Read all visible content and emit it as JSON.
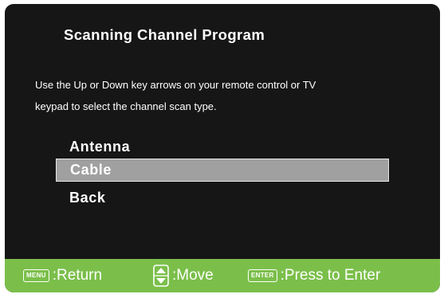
{
  "dialog": {
    "title": "Scanning Channel Program",
    "instruction_line_1": "Use the Up or Down key arrows on your remote control or TV",
    "instruction_line_2": "keypad to select the channel scan type."
  },
  "menu": {
    "selected": "Cable",
    "items": [
      {
        "label": "Antenna"
      },
      {
        "label": "Cable"
      },
      {
        "label": "Back"
      }
    ]
  },
  "footer": {
    "menu_key": "MENU",
    "return_label": ":Return",
    "move_icon": "up-down-arrows-icon",
    "move_label": ":Move",
    "enter_key": "ENTER",
    "enter_label": ":Press to Enter"
  },
  "colors": {
    "background": "#161616",
    "footer": "#7bbf4a",
    "highlight": "#a0a0a0",
    "text": "#ffffff"
  }
}
